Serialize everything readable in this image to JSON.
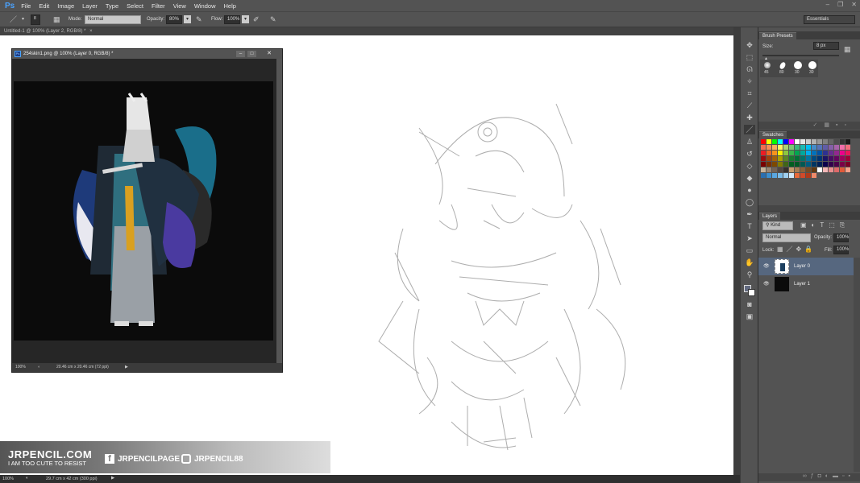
{
  "app": {
    "logo": "Ps",
    "menu": [
      "File",
      "Edit",
      "Image",
      "Layer",
      "Type",
      "Select",
      "Filter",
      "View",
      "Window",
      "Help"
    ],
    "workspace": "Essentials"
  },
  "options": {
    "brush_size": "8",
    "mode_label": "Mode:",
    "mode": "Normal",
    "opacity_label": "Opacity:",
    "opacity": "80%",
    "flow_label": "Flow:",
    "flow": "100%"
  },
  "doc_tab": "Untitled-1 @ 100% (Layer 2, RGB/8) *",
  "doc_tab_close": "×",
  "status": {
    "zoom": "100%",
    "size": "29.7 cm x 42 cm (300 ppi)"
  },
  "float_doc": {
    "title": "254skin1.png @ 100% (Layer 0, RGB/8) *",
    "zoom": "100%",
    "size": "20.46 cm x 20.46 cm (72 ppi)"
  },
  "brush_presets": {
    "tab": "Brush Presets",
    "size_label": "Size:",
    "size": "8 px",
    "presets": [
      "45",
      "80",
      "30",
      "30"
    ]
  },
  "swatches": {
    "tab": "Swatches",
    "colors": [
      "#ff0000",
      "#ffff00",
      "#00ff00",
      "#00ffff",
      "#0000ff",
      "#ff00ff",
      "#ffffff",
      "#e6e6e6",
      "#cccccc",
      "#b3b3b3",
      "#999999",
      "#808080",
      "#666666",
      "#4d4d4d",
      "#333333",
      "#1a1a1a",
      "#f26c4f",
      "#f68e55",
      "#fbaf5c",
      "#fff467",
      "#acd372",
      "#7cc576",
      "#3bb878",
      "#1abbb4",
      "#00bff3",
      "#438ccb",
      "#5574b9",
      "#605ca8",
      "#855fa8",
      "#a763a9",
      "#f06ea9",
      "#f26d7d",
      "#ed1c24",
      "#f26522",
      "#f7941d",
      "#fff200",
      "#8dc63f",
      "#39b54a",
      "#00a651",
      "#00a99d",
      "#00aeef",
      "#0072bc",
      "#0054a6",
      "#2e3192",
      "#662d91",
      "#92278f",
      "#ec008c",
      "#ed145b",
      "#9e0b0f",
      "#a0410d",
      "#a36209",
      "#aba000",
      "#598527",
      "#197b30",
      "#007236",
      "#00746b",
      "#0076a3",
      "#004b80",
      "#003471",
      "#1b1464",
      "#440e62",
      "#630460",
      "#9e005d",
      "#9e0039",
      "#790000",
      "#7b2e00",
      "#7d4900",
      "#827b00",
      "#406618",
      "#005e20",
      "#005826",
      "#005952",
      "#005b7f",
      "#003663",
      "#002157",
      "#0d004c",
      "#32004b",
      "#4b0049",
      "#7b0046",
      "#7a0026",
      "#c7b299",
      "#998675",
      "#736357",
      "#534741",
      "#37302d",
      "#c69c6d",
      "#a67c52",
      "#8c6239",
      "#754c24",
      "#603913",
      "#ffffff",
      "#f2b6b6",
      "#e89090",
      "#de6a6a",
      "#e05a3a",
      "#f7a08a",
      "#2a6fb0",
      "#3b8fd0",
      "#5aa7e0",
      "#7bbce8",
      "#a0d0f0",
      "#d0e8f8",
      "#e86a3a",
      "#d04a2a",
      "#b03a1a",
      "#f08a6a"
    ]
  },
  "layers": {
    "tab": "Layers",
    "filter": "Kind",
    "blend": "Normal",
    "opacity_label": "Opacity:",
    "opacity": "100%",
    "lock_label": "Lock:",
    "fill_label": "Fill:",
    "fill": "100%",
    "items": [
      {
        "name": "Layer 0",
        "selected": true
      },
      {
        "name": "Layer 1",
        "selected": false
      }
    ]
  },
  "banner": {
    "site": "JRPENCIL.COM",
    "tagline": "I AM TOO CUTE TO RESIST",
    "facebook": "JRPENCILPAGE",
    "instagram": "JRPENCIL88"
  },
  "colors": {
    "accent": "#4aa3ff",
    "selected_layer": "#56677f"
  }
}
